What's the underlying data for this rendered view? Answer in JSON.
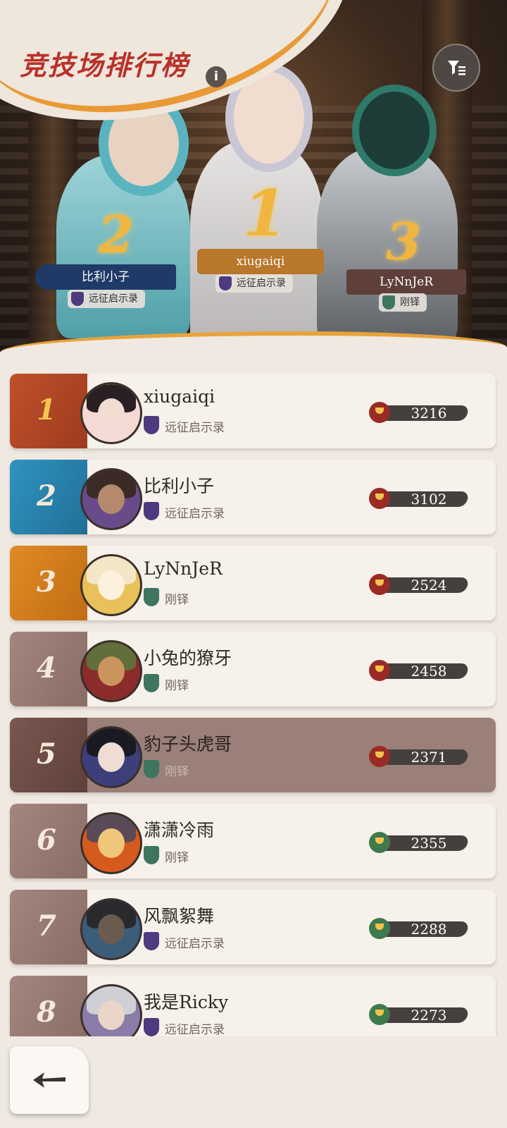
{
  "page": {
    "title": "竞技场排行榜"
  },
  "podium": [
    {
      "place": "2",
      "name": "比利小子",
      "guild": "远征启示录",
      "guild_color": "#5a3f86",
      "name_bar_color": "#1f3a66"
    },
    {
      "place": "1",
      "name": "xiugaiqi",
      "guild": "远征启示录",
      "guild_color": "#5a3f86",
      "name_bar_color": "#b8772a"
    },
    {
      "place": "3",
      "name": "LyNnJeR",
      "guild": "刚铎",
      "guild_color": "#3f7a66",
      "name_bar_color": "#5e3f3a"
    }
  ],
  "rankings": [
    {
      "rank": "1",
      "name": "xiugaiqi",
      "guild": "远征启示录",
      "guild_type": "expedition",
      "score": "3216",
      "trophy": "red",
      "rank_color": "#b8502a",
      "highlight": false
    },
    {
      "rank": "2",
      "name": "比利小子",
      "guild": "远征启示录",
      "guild_type": "expedition",
      "score": "3102",
      "trophy": "red",
      "rank_color": "#2d86b3",
      "highlight": false
    },
    {
      "rank": "3",
      "name": "LyNnJeR",
      "guild": "刚铎",
      "guild_type": "gondor",
      "score": "2524",
      "trophy": "red",
      "rank_color": "#d77d1e",
      "highlight": false
    },
    {
      "rank": "4",
      "name": "小兔的獠牙",
      "guild": "刚铎",
      "guild_type": "gondor",
      "score": "2458",
      "trophy": "red",
      "rank_color": "#9b7e7a",
      "highlight": false
    },
    {
      "rank": "5",
      "name": "豹子头虎哥",
      "guild": "刚铎",
      "guild_type": "gondor",
      "score": "2371",
      "trophy": "red",
      "rank_color": "#6e4e48",
      "highlight": true
    },
    {
      "rank": "6",
      "name": "潇潇冷雨",
      "guild": "刚铎",
      "guild_type": "gondor",
      "score": "2355",
      "trophy": "green",
      "rank_color": "#9b7e7a",
      "highlight": false
    },
    {
      "rank": "7",
      "name": "风飘絮舞",
      "guild": "远征启示录",
      "guild_type": "expedition",
      "score": "2288",
      "trophy": "green",
      "rank_color": "#9b7e7a",
      "highlight": false
    },
    {
      "rank": "8",
      "name": "我是Ricky",
      "guild": "远征启示录",
      "guild_type": "expedition",
      "score": "2273",
      "trophy": "green",
      "rank_color": "#9b7e7a",
      "highlight": false
    }
  ],
  "colors": {
    "guild_expedition": "#4e3a7e",
    "guild_gondor": "#3f7560",
    "trophy_red": "#9a2a25",
    "trophy_green": "#3f7a4e"
  },
  "icons": {
    "info": "i",
    "filter": "filter-icon",
    "back": "back-arrow-icon"
  }
}
